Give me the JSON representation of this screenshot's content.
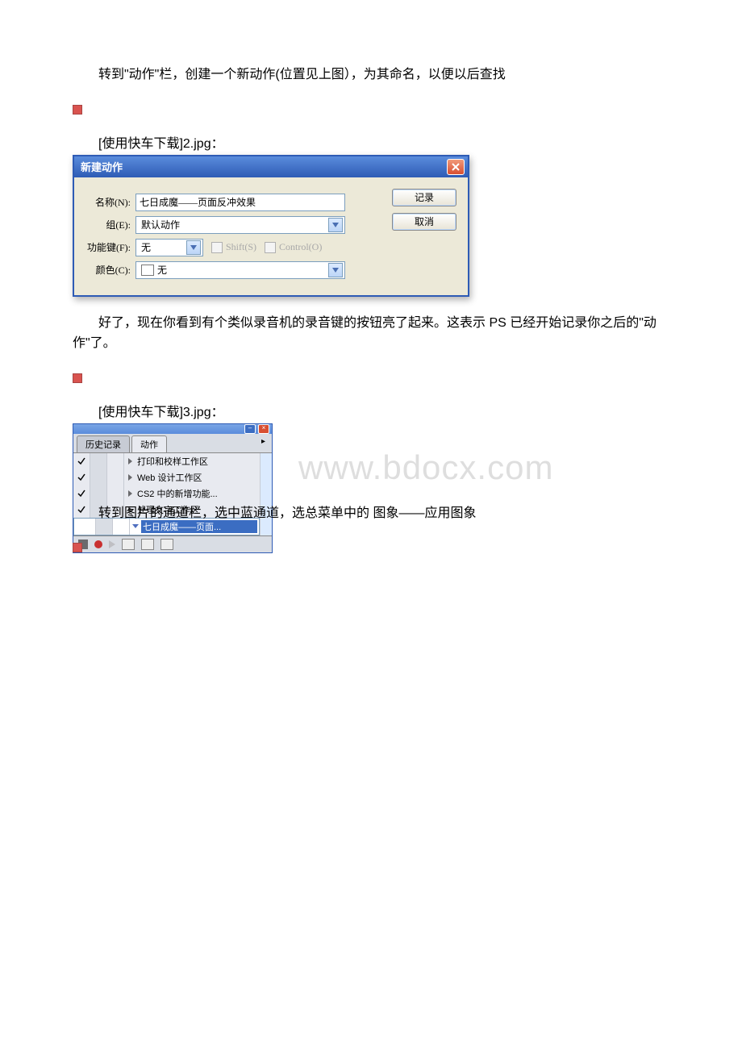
{
  "para1": "转到\"动作\"栏，创建一个新动作(位置见上图），为其命名，以便以后查找",
  "caption2": "[使用快车下载]2.jpg：",
  "dlg": {
    "title": "新建动作",
    "name_label": "名称(N):",
    "name_value": "七日成魔——页面反冲效果",
    "group_label": "组(E):",
    "group_value": "默认动作",
    "fkey_label": "功能键(F):",
    "fkey_value": "无",
    "shift": "Shift(S)",
    "ctrl": "Control(O)",
    "color_label": "颜色(C):",
    "color_value": "无",
    "btn_record": "记录",
    "btn_cancel": "取消"
  },
  "para2": "好了，现在你看到有个类似录音机的录音键的按钮亮了起来。这表示 PS 已经开始记录你之后的\"动作\"了。",
  "caption3": "[使用快车下载]3.jpg：",
  "mini": {
    "tab1": "历史记录",
    "tab2": "动作",
    "items": [
      "打印和校样工作区",
      "Web 设计工作区",
      "CS2 中的新增功能...",
      "处理文字工作区",
      "七日成魔——页面..."
    ]
  },
  "para3": "转到图片的通道栏，选中蓝通道，选总菜单中的 图象——应用图象",
  "watermark": "www.bdocx.com"
}
